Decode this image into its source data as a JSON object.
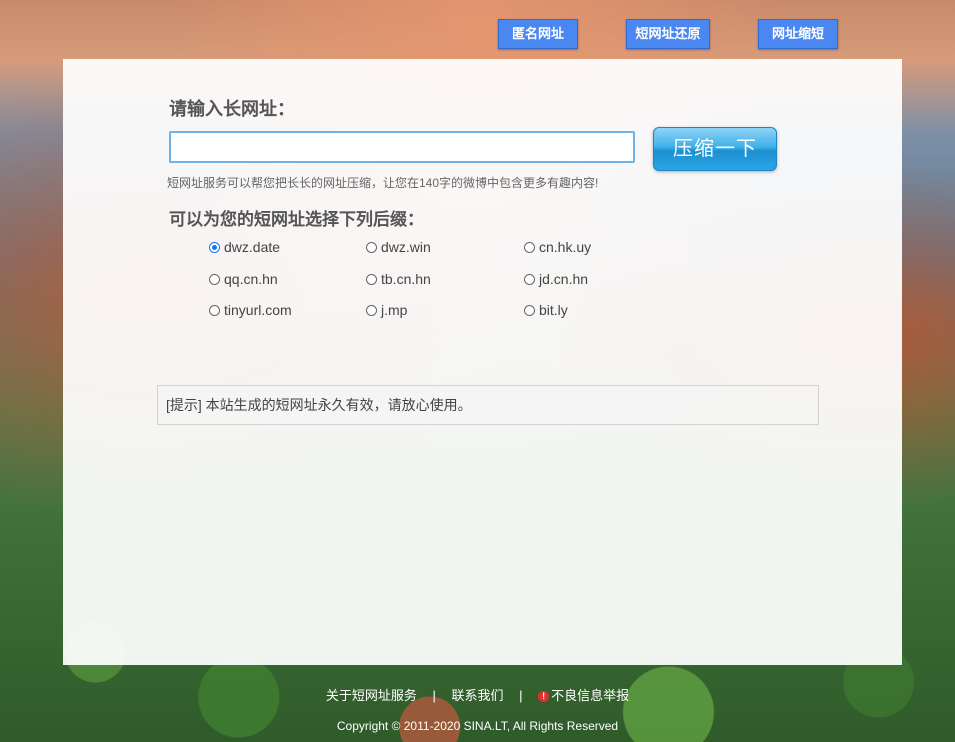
{
  "nav": {
    "anonymous": "匿名网址",
    "restore": "短网址还原",
    "shorten": "网址缩短"
  },
  "form": {
    "label": "请输入长网址：",
    "input_value": "",
    "input_placeholder": "",
    "compress_button": "压缩一下",
    "help": "短网址服务可以帮您把长长的网址压缩，让您在140字的微博中包含更多有趣内容!",
    "suffix_title": "可以为您的短网址选择下列后缀："
  },
  "suffixes": [
    {
      "label": "dwz.date",
      "checked": true
    },
    {
      "label": "dwz.win",
      "checked": false
    },
    {
      "label": "cn.hk.uy",
      "checked": false
    },
    {
      "label": "qq.cn.hn",
      "checked": false
    },
    {
      "label": "tb.cn.hn",
      "checked": false
    },
    {
      "label": "jd.cn.hn",
      "checked": false
    },
    {
      "label": "tinyurl.com",
      "checked": false
    },
    {
      "label": "j.mp",
      "checked": false
    },
    {
      "label": "bit.ly",
      "checked": false
    }
  ],
  "tip": "[提示] 本站生成的短网址永久有效，请放心使用。",
  "footer": {
    "about": "关于短网址服务",
    "contact": "联系我们",
    "report": "不良信息举报",
    "separator": "|",
    "warn_icon": "alert-icon",
    "copyright": "Copyright © 2011-2020 SINA.LT, All Rights Reserved"
  }
}
